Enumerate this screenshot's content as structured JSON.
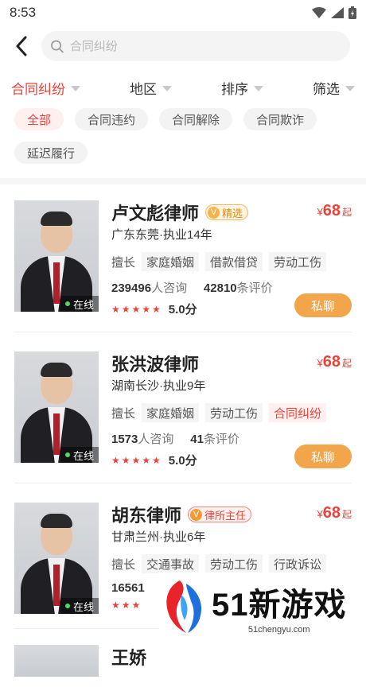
{
  "status": {
    "time": "8:53"
  },
  "search": {
    "placeholder": "合同纠纷"
  },
  "filters": [
    "合同纠纷",
    "地区",
    "排序",
    "筛选"
  ],
  "chips": [
    "全部",
    "合同违约",
    "合同解除",
    "合同欺诈",
    "延迟履行"
  ],
  "lawyers": [
    {
      "name": "卢文彪律师",
      "badge": "精选",
      "price": "68",
      "price_symbol": "¥",
      "price_unit": "起",
      "location": "广东东莞·执业14年",
      "tag_label": "擅长",
      "tags": [
        "家庭婚姻",
        "借款借贷",
        "劳动工伤"
      ],
      "consult_count": "239496",
      "consult_label": "人咨询",
      "review_count": "42810",
      "review_label": "条评价",
      "rating": "5.0分",
      "online": "在线",
      "chat_label": "私聊"
    },
    {
      "name": "张洪波律师",
      "badge": "",
      "price": "68",
      "price_symbol": "¥",
      "price_unit": "起",
      "location": "湖南长沙·执业9年",
      "tag_label": "擅长",
      "tags": [
        "家庭婚姻",
        "劳动工伤",
        "合同纠纷"
      ],
      "consult_count": "1573",
      "consult_label": "人咨询",
      "review_count": "41",
      "review_label": "条评价",
      "rating": "5.0分",
      "online": "在线",
      "chat_label": "私聊"
    },
    {
      "name": "胡东律师",
      "badge": "律所主任",
      "price": "68",
      "price_symbol": "¥",
      "price_unit": "起",
      "location": "甘肃兰州·执业6年",
      "tag_label": "擅长",
      "tags": [
        "交通事故",
        "劳动工伤",
        "行政诉讼"
      ],
      "consult_count": "16561",
      "online": "在线"
    }
  ],
  "partial_name": "王娇",
  "watermark": {
    "title": "51新游戏",
    "url": "51chengyu.com"
  }
}
